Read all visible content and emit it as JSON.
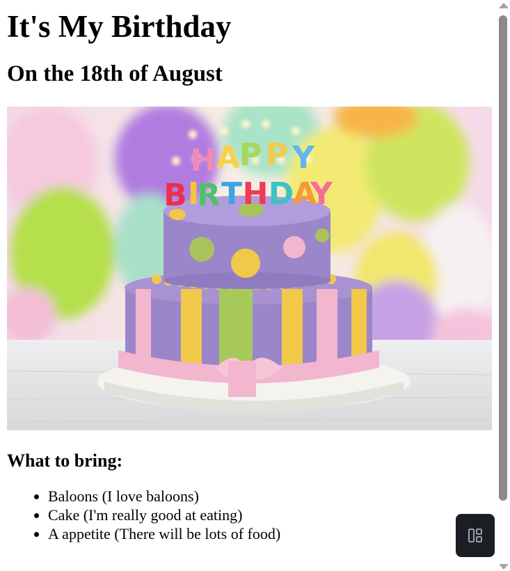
{
  "page": {
    "title": "It's My Birthday",
    "subtitle": "On the 18th of August",
    "image_alt": "Two-tier birthday cake with HAPPY BIRTHDAY candles in front of colorful balloons"
  },
  "cake_candles": {
    "line1": [
      "H",
      "A",
      "P",
      "P",
      "Y"
    ],
    "line2": [
      "B",
      "I",
      "R",
      "T",
      "H",
      "D",
      "A",
      "Y"
    ]
  },
  "bring": {
    "heading": "What to bring:",
    "items": [
      "Baloons (I love baloons)",
      "Cake (I'm really good at eating)",
      "A appetite (There will be lots of food)"
    ]
  },
  "colors": {
    "fab_bg": "#1b1f24",
    "scroll_thumb": "#8b8b8b",
    "cake_purple": "#9b86c9",
    "cake_pink": "#f2b6cf",
    "cake_yellow": "#f2c84b",
    "cake_green": "#a7c95a"
  },
  "icons": {
    "fab": "layout-panels-icon",
    "scroll_up": "triangle-up-icon",
    "scroll_down": "triangle-down-icon"
  }
}
